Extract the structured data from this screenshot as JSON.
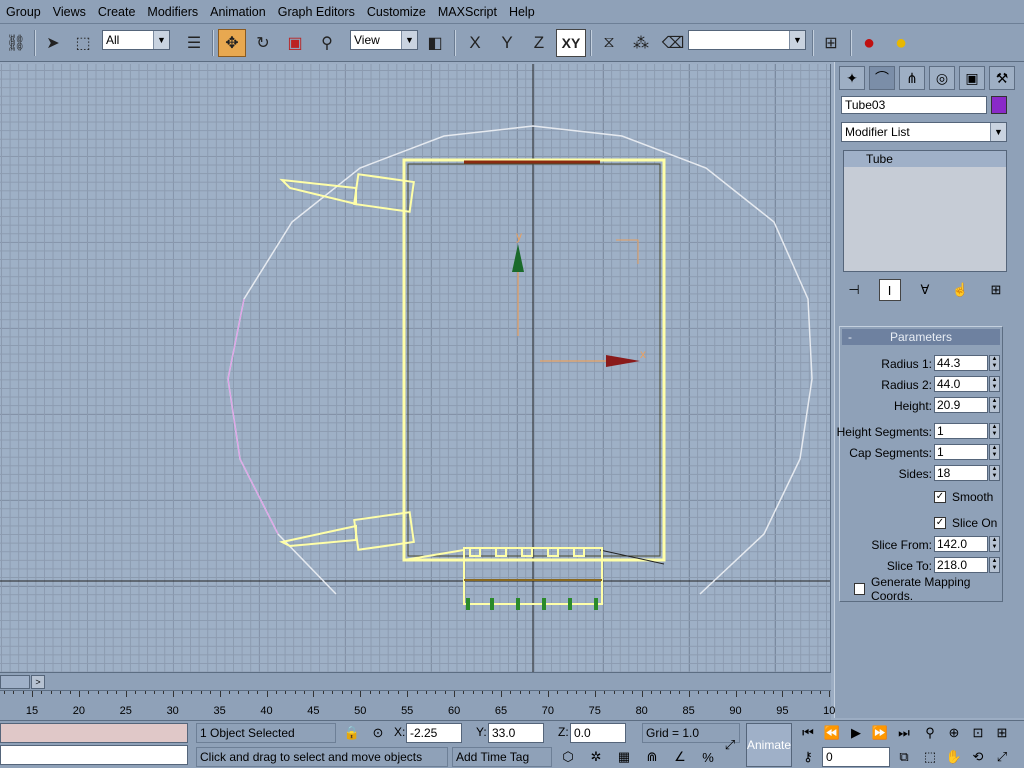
{
  "menu": [
    "Group",
    "Views",
    "Create",
    "Modifiers",
    "Animation",
    "Graph Editors",
    "Customize",
    "MAXScript",
    "Help"
  ],
  "toolbar": {
    "selection_filter": "All",
    "ref_coord": "View",
    "axis_x": "X",
    "axis_y": "Y",
    "axis_z": "Z",
    "axis_xy": "XY",
    "named_selection": ""
  },
  "viewport": {
    "gizmo_x_label": "x",
    "gizmo_y_label": "y"
  },
  "command_panel": {
    "object_name": "Tube03",
    "object_color": "#8a2ac8",
    "modifier_list": "Modifier List",
    "stack_items": [
      "Tube"
    ],
    "rollout_title": "Parameters",
    "rollout_toggle": "-",
    "params": [
      {
        "label": "Radius 1:",
        "value": "44.3"
      },
      {
        "label": "Radius 2:",
        "value": "44.0"
      },
      {
        "label": "Height:",
        "value": "20.9"
      },
      {
        "label": "Height Segments:",
        "value": "1"
      },
      {
        "label": "Cap Segments:",
        "value": "1"
      },
      {
        "label": "Sides:",
        "value": "18"
      }
    ],
    "smooth_label": "Smooth",
    "smooth_checked": true,
    "slice_on_label": "Slice On",
    "slice_on_checked": true,
    "slice_params": [
      {
        "label": "Slice From:",
        "value": "142.0"
      },
      {
        "label": "Slice To:",
        "value": "218.0"
      }
    ],
    "gen_mapping_label": "Generate Mapping Coords.",
    "gen_mapping_checked": false
  },
  "timeline": {
    "ticks": [
      "15",
      "20",
      "25",
      "30",
      "35",
      "40",
      "45",
      "50",
      "55",
      "60",
      "65",
      "70",
      "75",
      "80",
      "85",
      "90",
      "95",
      "10"
    ],
    "scroll_arrow": ">"
  },
  "status": {
    "selection_info": "1 Object Selected",
    "prompt": "Click and drag to select and move objects",
    "x_label": "X:",
    "x_value": "-2.25",
    "y_label": "Y:",
    "y_value": "33.0",
    "z_label": "Z:",
    "z_value": "0.0",
    "grid": "Grid = 1.0",
    "add_time_tag": "Add Time Tag",
    "animate": "Animate",
    "frame": "0"
  }
}
